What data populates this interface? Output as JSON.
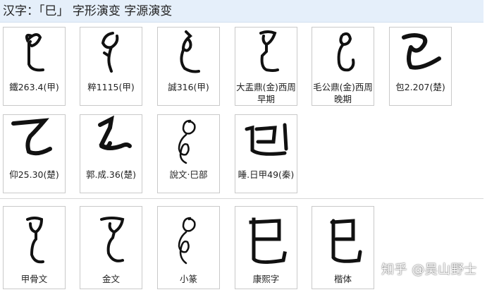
{
  "header": {
    "title": "汉字：「巳」 字形演变 字源演变"
  },
  "rows": [
    {
      "cells": [
        {
          "caption": "鐵263.4(甲)"
        },
        {
          "caption": "粹1115(甲)"
        },
        {
          "caption": "誠316(甲)"
        },
        {
          "caption": "大盂鼎(金)西周早期"
        },
        {
          "caption": "毛公鼎(金)西周晚期"
        },
        {
          "caption": "包2.207(楚)"
        }
      ]
    },
    {
      "cells": [
        {
          "caption": "仰25.30(楚)"
        },
        {
          "caption": "郭.成.36(楚)"
        },
        {
          "caption": "說文‧巳部"
        },
        {
          "caption": "睡.日甲49(秦)"
        }
      ]
    },
    {
      "cells": [
        {
          "caption": "甲骨文"
        },
        {
          "caption": "金文"
        },
        {
          "caption": "小篆"
        },
        {
          "caption": "康熙字"
        },
        {
          "caption": "楷体"
        }
      ]
    }
  ],
  "watermark": "知乎 @吴山野士",
  "colors": {
    "header_bg": "#e5effa",
    "border": "#c9c9c9",
    "ink": "#111111"
  }
}
